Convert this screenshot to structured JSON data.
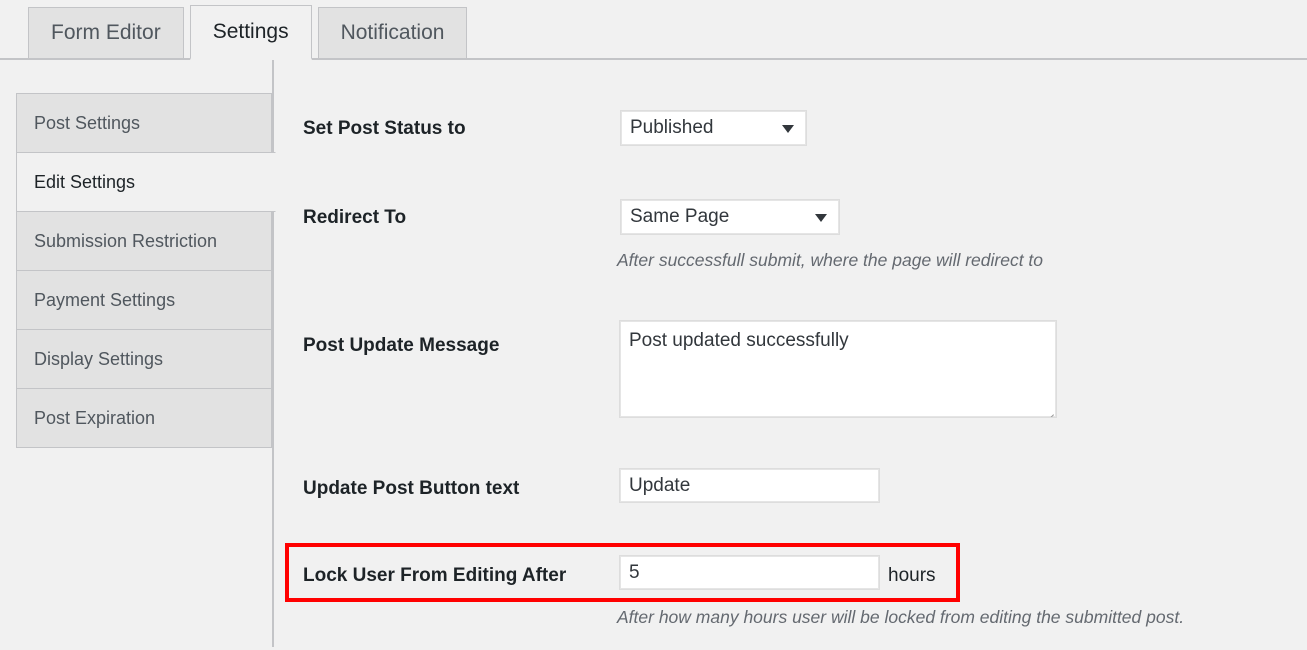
{
  "tabs": [
    {
      "label": "Form Editor",
      "active": false
    },
    {
      "label": "Settings",
      "active": true
    },
    {
      "label": "Notification",
      "active": false
    }
  ],
  "sidenav": {
    "items": [
      {
        "label": "Post Settings",
        "active": false
      },
      {
        "label": "Edit Settings",
        "active": true
      },
      {
        "label": "Submission Restriction",
        "active": false
      },
      {
        "label": "Payment Settings",
        "active": false
      },
      {
        "label": "Display Settings",
        "active": false
      },
      {
        "label": "Post Expiration",
        "active": false
      }
    ]
  },
  "form": {
    "post_status": {
      "label": "Set Post Status to",
      "value": "Published"
    },
    "redirect_to": {
      "label": "Redirect To",
      "value": "Same Page",
      "description": "After successfull submit, where the page will redirect to"
    },
    "post_update_message": {
      "label": "Post Update Message",
      "value": "Post updated successfully"
    },
    "update_button_text": {
      "label": "Update Post Button text",
      "value": "Update"
    },
    "lock_user": {
      "label": "Lock User From Editing After",
      "value": "5",
      "suffix": "hours",
      "description": "After how many hours user will be locked from editing the submitted post."
    }
  },
  "colors": {
    "highlight": "#ff0000",
    "page_background": "#f1f1f1",
    "inactive_tab": "#e2e2e2",
    "border": "#c3c4c7"
  }
}
